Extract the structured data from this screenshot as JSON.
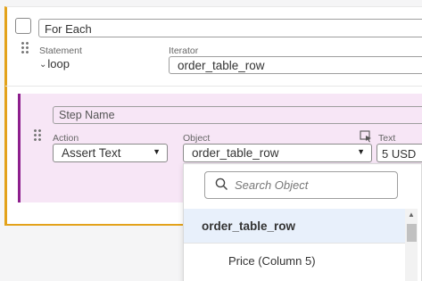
{
  "loop_block": {
    "title": "For Each",
    "statement_label": "Statement",
    "statement_value": "loop",
    "iterator_label": "Iterator",
    "iterator_value": "order_table_row"
  },
  "step": {
    "name_placeholder": "Step Name",
    "action_label": "Action",
    "action_value": "Assert Text",
    "object_label": "Object",
    "object_value": "order_table_row",
    "text_label": "Text",
    "text_value": "5 USD"
  },
  "object_dropdown": {
    "search_placeholder": "Search Object",
    "options": [
      {
        "label": "order_table_row"
      },
      {
        "label": "Price (Column 5)"
      }
    ]
  },
  "colors": {
    "loop_accent": "#e3a21a",
    "step_accent": "#8d1f8d",
    "step_background": "#f7e6f6",
    "selected_option_background": "#e8f0fb"
  },
  "icons": {
    "drag": "drag-handle-icon",
    "chevron": "chevron-down-icon",
    "search": "search-icon",
    "picker": "element-picker-icon",
    "dropdown_arrow": "dropdown-arrow-icon"
  }
}
